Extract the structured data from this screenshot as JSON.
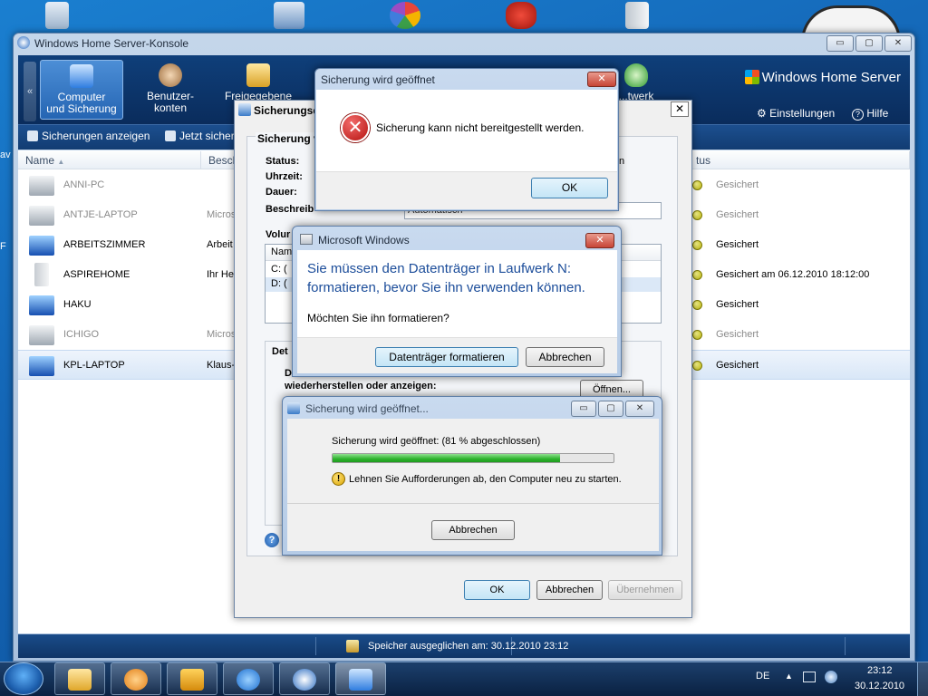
{
  "desktop": {
    "left_sliver": [
      "av",
      "F"
    ]
  },
  "window": {
    "title": "Windows Home Server-Konsole",
    "caption": {
      "minimize": "▭",
      "maximize": "▢",
      "close": "✕"
    }
  },
  "ribbon": {
    "collapse": "«",
    "tabs": [
      {
        "label_line1": "Computer",
        "label_line2": "und Sicherung",
        "active": true
      },
      {
        "label_line1": "Benutzer-",
        "label_line2": "konten"
      },
      {
        "label_line1": "Freigegebene",
        "label_line2": ""
      },
      {
        "label_line1": "...twerk",
        "label_line2": ""
      }
    ],
    "brand": "Windows Home Server",
    "settings": "Einstellungen",
    "help": "Hilfe"
  },
  "toolbar": {
    "show_backups": "Sicherungen anzeigen",
    "backup_now": "Jetzt sicherr"
  },
  "list": {
    "headers": {
      "name": "Name",
      "desc": "Besch",
      "status": "tus"
    },
    "rows": [
      {
        "name": "ANNI-PC",
        "desc": "",
        "status": "Gesichert",
        "dim": true,
        "type": "laptop"
      },
      {
        "name": "ANTJE-LAPTOP",
        "desc": "Micros",
        "status": "Gesichert",
        "dim": true,
        "type": "laptop"
      },
      {
        "name": "ARBEITSZIMMER",
        "desc": "Arbeit",
        "status": "Gesichert",
        "dim": false,
        "type": "monitor"
      },
      {
        "name": "ASPIREHOME",
        "desc": "Ihr He",
        "status": "Gesichert am 06.12.2010 18:12:00",
        "dim": false,
        "type": "tower"
      },
      {
        "name": "HAKU",
        "desc": "",
        "status": "Gesichert",
        "dim": false,
        "type": "monitor"
      },
      {
        "name": "ICHIGO",
        "desc": "Micros",
        "status": "Gesichert",
        "dim": true,
        "type": "laptop"
      },
      {
        "name": "KPL-LAPTOP",
        "desc": "Klaus-",
        "status": "Gesichert",
        "dim": false,
        "type": "monitor",
        "selected": true
      }
    ]
  },
  "statusbar": {
    "text": "Speicher ausgeglichen am: 30.12.2010 23:12"
  },
  "props_dialog": {
    "title": "Sicherungsd",
    "close": "✕",
    "group_title": "Sicherung v",
    "status_label": "Status:",
    "time_label": "Uhrzeit:",
    "duration_label": "Dauer:",
    "desc_label": "Beschreib",
    "desc_value": "Automatisch",
    "status_side": "n",
    "volumes_title": "Volur",
    "vol_header": "Nam",
    "vol_c": "C: (",
    "vol_d": "D: (",
    "details_title": "Det",
    "details_line1": "D",
    "details_line2": "wiederherstellen oder anzeigen:",
    "open_btn": "Öffnen...",
    "help_icon": "?",
    "ok": "OK",
    "cancel": "Abbrechen",
    "apply": "Übernehmen"
  },
  "error_dialog": {
    "title": "Sicherung wird geöffnet",
    "message": "Sicherung kann nicht bereitgestellt werden.",
    "ok": "OK",
    "icon": "✕",
    "close": "✕"
  },
  "format_dialog": {
    "title": "Microsoft Windows",
    "headline_1": "Sie müssen den Datenträger in Laufwerk N:",
    "headline_2": "formatieren, bevor Sie ihn verwenden können.",
    "question": "Möchten Sie ihn formatieren?",
    "format_btn": "Datenträger formatieren",
    "cancel_btn": "Abbrechen",
    "close": "✕"
  },
  "progress_dialog": {
    "title": "Sicherung wird geöffnet...",
    "status": "Sicherung wird geöffnet: (81 % abgeschlossen)",
    "progress": 0.81,
    "warning_icon": "!",
    "warning": "Lehnen Sie Aufforderungen ab, den Computer neu zu starten.",
    "cancel": "Abbrechen",
    "caption": {
      "minimize": "▭",
      "maximize": "▢",
      "close": "✕"
    }
  },
  "taskbar": {
    "lang": "DE",
    "time": "23:12",
    "date": "30.12.2010",
    "tray_up": "▲"
  }
}
